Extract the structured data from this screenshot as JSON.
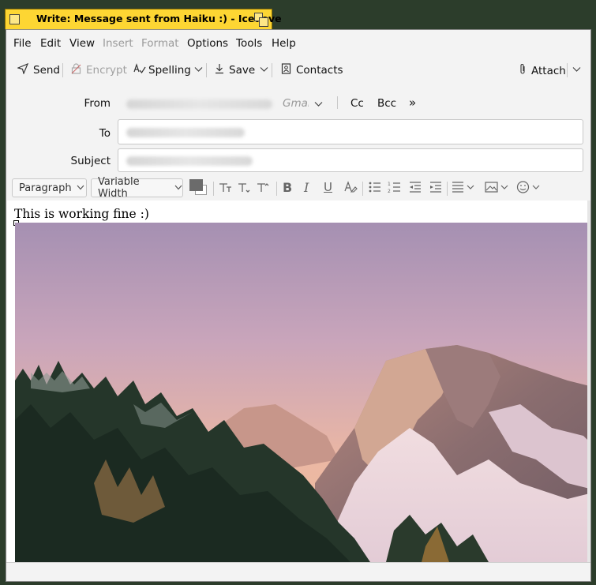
{
  "window": {
    "title": "Write: Message sent from Haiku :) - Icedove"
  },
  "menu": [
    "File",
    "Edit",
    "View",
    "Insert",
    "Format",
    "Options",
    "Tools",
    "Help"
  ],
  "toolbar": {
    "send": "Send",
    "encrypt": "Encrypt",
    "spelling": "Spelling",
    "save": "Save",
    "contacts": "Contacts",
    "attach": "Attach"
  },
  "headers": {
    "from_label": "From",
    "from_account": "Gmail",
    "cc": "Cc",
    "bcc": "Bcc",
    "to_label": "To",
    "subject_label": "Subject"
  },
  "format": {
    "paragraph": "Paragraph",
    "font": "Variable Width"
  },
  "message": {
    "text": "This is working fine :)"
  },
  "colors": {
    "tab_yellow": "#fdd633",
    "desktop": "#2c3d2b"
  }
}
